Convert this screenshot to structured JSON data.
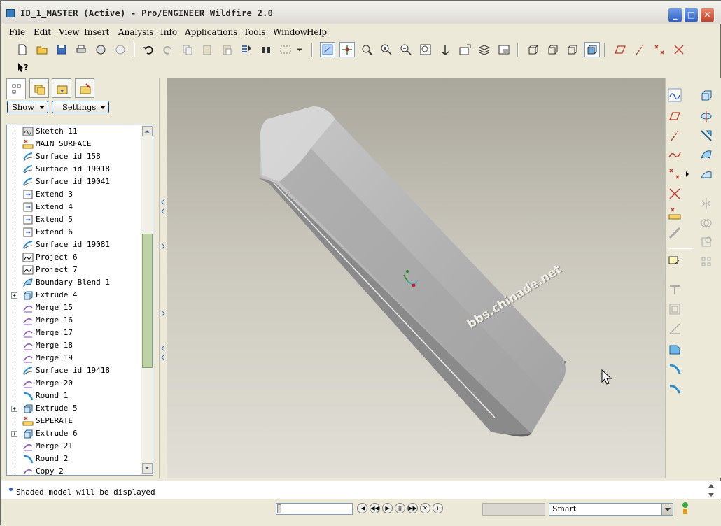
{
  "window": {
    "title": "ID_1_MASTER (Active) - Pro/ENGINEER Wildfire 2.0",
    "min_label": "_",
    "max_label": "□",
    "close_label": "✕"
  },
  "menu": [
    "File",
    "Edit",
    "View",
    "Insert",
    "Analysis",
    "Info",
    "Applications",
    "Tools",
    "Window",
    "Help"
  ],
  "panel": {
    "show_label": "Show",
    "settings_label": "Settings"
  },
  "tree": [
    {
      "label": "Sketch 11",
      "icon": "sketch-icon",
      "exp": false
    },
    {
      "label": "MAIN_SURFACE",
      "icon": "datum-point-icon",
      "exp": false
    },
    {
      "label": "Surface id 158",
      "icon": "surface-icon",
      "exp": false
    },
    {
      "label": "Surface id 19018",
      "icon": "surface-icon",
      "exp": false
    },
    {
      "label": "Surface id 19041",
      "icon": "surface-icon",
      "exp": false
    },
    {
      "label": "Extend 3",
      "icon": "extend-icon",
      "exp": false
    },
    {
      "label": "Extend 4",
      "icon": "extend-icon",
      "exp": false
    },
    {
      "label": "Extend 5",
      "icon": "extend-icon",
      "exp": false
    },
    {
      "label": "Extend 6",
      "icon": "extend-icon",
      "exp": false
    },
    {
      "label": "Surface id 19081",
      "icon": "surface-icon",
      "exp": false
    },
    {
      "label": "Project 6",
      "icon": "project-icon",
      "exp": false
    },
    {
      "label": "Project 7",
      "icon": "project-icon",
      "exp": false
    },
    {
      "label": "Boundary Blend 1",
      "icon": "boundary-blend-icon",
      "exp": false
    },
    {
      "label": "Extrude 4",
      "icon": "extrude-icon",
      "exp": true
    },
    {
      "label": "Merge 15",
      "icon": "merge-icon",
      "exp": false
    },
    {
      "label": "Merge 16",
      "icon": "merge-icon",
      "exp": false
    },
    {
      "label": "Merge 17",
      "icon": "merge-icon",
      "exp": false
    },
    {
      "label": "Merge 18",
      "icon": "merge-icon",
      "exp": false
    },
    {
      "label": "Merge 19",
      "icon": "merge-icon",
      "exp": false
    },
    {
      "label": "Surface id 19418",
      "icon": "surface-icon",
      "exp": false
    },
    {
      "label": "Merge 20",
      "icon": "merge-icon",
      "exp": false
    },
    {
      "label": "Round 1",
      "icon": "round-icon",
      "exp": false
    },
    {
      "label": "Extrude 5",
      "icon": "extrude-icon",
      "exp": true
    },
    {
      "label": "SEPERATE",
      "icon": "datum-point-icon",
      "exp": false
    },
    {
      "label": "Extrude 6",
      "icon": "extrude-icon",
      "exp": true
    },
    {
      "label": "Merge 21",
      "icon": "merge-icon",
      "exp": false
    },
    {
      "label": "Round 2",
      "icon": "round-icon",
      "exp": false
    },
    {
      "label": "Copy 2",
      "icon": "copy-icon",
      "exp": false
    }
  ],
  "viewport": {
    "watermark": "bbs.chinade.net"
  },
  "status": {
    "message": "Shaded model will be displayed",
    "filter": "Smart",
    "prev_label": "◀",
    "next_label": "▶",
    "playback": [
      "|◀",
      "◀◀",
      "▶",
      "||",
      "▶▶",
      "✕",
      "i"
    ]
  },
  "colors": {
    "accent": "#2a5bd7",
    "viewport_top": "#a9a69c",
    "viewport_bottom": "#e2e0d6",
    "model": "#9c9c9c"
  }
}
